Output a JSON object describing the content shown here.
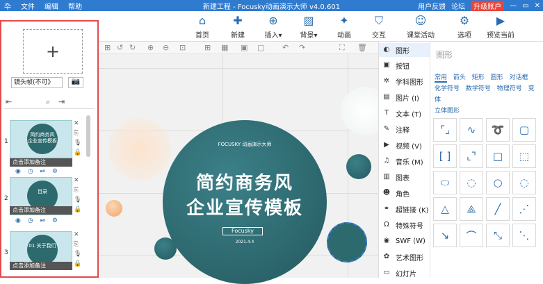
{
  "titlebar": {
    "app_icon": "卆",
    "menu": [
      "文件",
      "编辑",
      "帮助"
    ],
    "title": "新建工程 - Focusky动画演示大师 v4.0.601",
    "feedback": "用户反馈",
    "forum": "论坛",
    "upgrade": "升级账户",
    "window_controls": [
      "—",
      "▭",
      "✕"
    ]
  },
  "toolbar": {
    "items": [
      {
        "label": "首页",
        "icon": "home-icon",
        "glyph": "⌂"
      },
      {
        "label": "新建",
        "icon": "new-file-icon",
        "glyph": "✚"
      },
      {
        "label": "插入▾",
        "icon": "insert-icon",
        "glyph": "⊕"
      },
      {
        "label": "背景▾",
        "icon": "background-icon",
        "glyph": "▨"
      },
      {
        "label": "动画",
        "icon": "animation-icon",
        "glyph": "✦"
      },
      {
        "label": "交互",
        "icon": "interaction-icon",
        "glyph": "⛉"
      },
      {
        "label": "课堂活动",
        "icon": "classroom-icon",
        "glyph": "☺"
      },
      {
        "label": "选项",
        "icon": "gear-icon",
        "glyph": "⚙"
      },
      {
        "label": "预览当前",
        "icon": "preview-icon",
        "glyph": "▶"
      }
    ]
  },
  "left_panel": {
    "add_symbol": "+",
    "frame_select": "镜头帧(不可》",
    "camera_glyph": "📷",
    "slides": [
      {
        "num": "1",
        "title": "简约商务风 企业宣传模板",
        "note": "点击添加备注"
      },
      {
        "num": "2",
        "title": "目录",
        "note": "点击添加备注"
      },
      {
        "num": "3",
        "title": "01 关于我们",
        "note": "点击添加备注"
      }
    ]
  },
  "canvas": {
    "logo": "FOCUSKY 动画演示大师",
    "line1": "简约商务风",
    "line2": "企业宣传模板",
    "tag": "Focusky",
    "date": "2021.4.4"
  },
  "inspector": {
    "items": [
      {
        "label": "图形",
        "glyph": "◐"
      },
      {
        "label": "按钮",
        "glyph": "▣"
      },
      {
        "label": "学科图形",
        "glyph": "✲"
      },
      {
        "label": "图片 (I)",
        "glyph": "▤"
      },
      {
        "label": "文本 (T)",
        "glyph": "T"
      },
      {
        "label": "注释",
        "glyph": "✎"
      },
      {
        "label": "视频 (V)",
        "glyph": "▶"
      },
      {
        "label": "音乐 (M)",
        "glyph": "♫"
      },
      {
        "label": "图表",
        "glyph": "▥"
      },
      {
        "label": "角色",
        "glyph": "☻"
      },
      {
        "label": "超链接 (K)",
        "glyph": "⚭"
      },
      {
        "label": "特殊符号",
        "glyph": "Ω"
      },
      {
        "label": "SWF (W)",
        "glyph": "◉"
      },
      {
        "label": "艺术图形",
        "glyph": "✿"
      },
      {
        "label": "幻灯片",
        "glyph": "▭"
      }
    ],
    "panel_title": "图形",
    "categories": [
      "常用",
      "箭头",
      "矩形",
      "圆形",
      "对话框",
      "化学符号",
      "数学符号",
      "物理符号",
      "变体",
      "立体图形"
    ]
  }
}
